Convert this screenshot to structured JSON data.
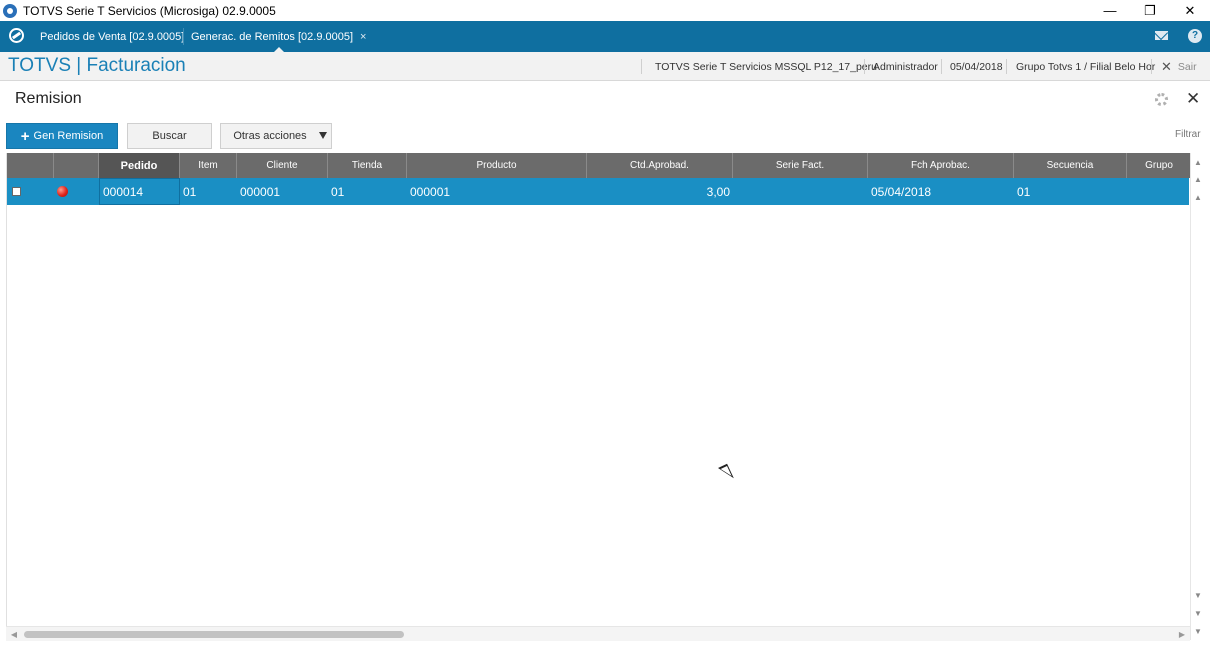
{
  "window": {
    "title": "TOTVS Serie T Servicios (Microsiga) 02.9.0005",
    "controls": {
      "minimize": "—",
      "restore": "❐",
      "close": "✕"
    }
  },
  "tabs": [
    {
      "label": "Pedidos de Venta [02.9.0005]",
      "close": "×",
      "active": false
    },
    {
      "label": "Generac. de Remitos [02.9.0005]",
      "close": "×",
      "active": true
    }
  ],
  "module": {
    "brand": "TOTVS | Facturacion",
    "environment": "TOTVS Serie T Servicios MSSQL P12_17_peru",
    "user": "Administrador",
    "date": "05/04/2018",
    "branch": "Grupo Totvs 1 / Filial Belo Hor",
    "exit_label": "Sair",
    "exit_icon": "✕"
  },
  "page": {
    "title": "Remision",
    "close_icon": "✕"
  },
  "toolbar": {
    "primary_label": "Gen Remision",
    "primary_icon": "+",
    "search_label": "Buscar",
    "more_label": "Otras acciones",
    "filter_label": "Filtrar"
  },
  "grid": {
    "columns": [
      "",
      "",
      "Pedido",
      "Item",
      "Cliente",
      "Tienda",
      "Producto",
      "Ctd.Aprobad.",
      "Serie Fact.",
      "Fch Aprobac.",
      "Secuencia",
      "Grupo"
    ],
    "rows": [
      {
        "checked": false,
        "status_color": "#e0241b",
        "pedido": "000014",
        "item": "01",
        "cliente": "000001",
        "tienda": "01",
        "producto": "000001",
        "ctd_aprobad": "3,00",
        "serie_fact": "",
        "fch_aprobac": "05/04/2018",
        "secuencia": "01",
        "grupo": ""
      }
    ]
  },
  "colors": {
    "tabbar": "#0f6fa0",
    "brand": "#1a80b6",
    "primary_button": "#1a86c0",
    "selected_row": "#1a8fc4",
    "grid_header": "#6b6b6b"
  }
}
